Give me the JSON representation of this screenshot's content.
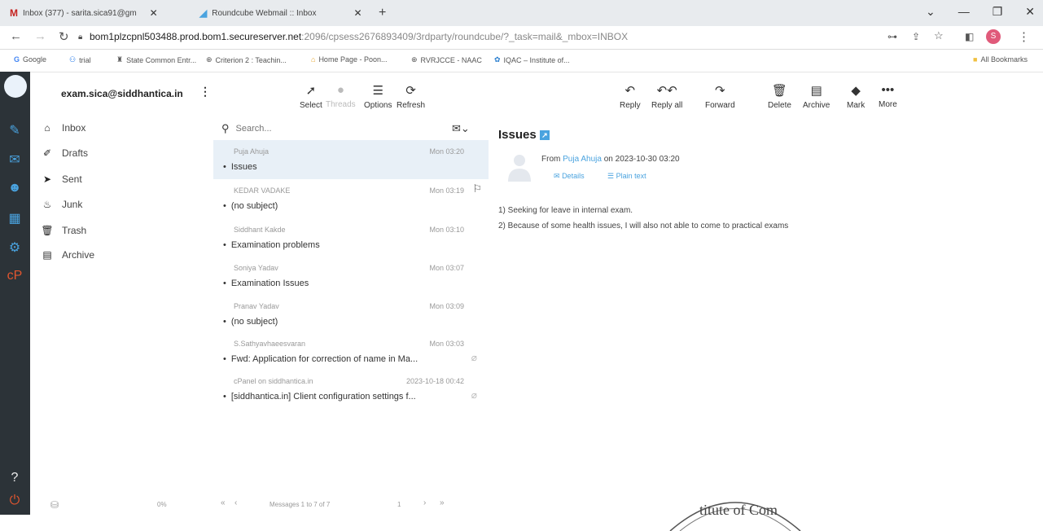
{
  "browser": {
    "tabs": [
      {
        "icon": "M",
        "title": "Inbox (377) - sarita.sica91@gm"
      },
      {
        "icon": "◢",
        "title": "Roundcube Webmail :: Inbox"
      }
    ],
    "new_tab": "+",
    "url_host": "bom1plzcpnl503488.prod.bom1.secureserver.net",
    "url_rest": ":2096/cpsess2676893409/3rdparty/roundcube/?_task=mail&_mbox=INBOX",
    "bookmarks": [
      "Google",
      "trial",
      "State Common Entr...",
      "Criterion 2 : Teachin...",
      "Home Page - Poon...",
      "RVRJCCE - NAAC",
      "IQAC – Institute of..."
    ],
    "all_bookmarks": "All Bookmarks",
    "profile_letter": "S"
  },
  "account": {
    "email": "exam.sica@siddhantica.in"
  },
  "folders": [
    {
      "icon": "inbox-icon",
      "label": "Inbox"
    },
    {
      "icon": "pencil-icon",
      "label": "Drafts"
    },
    {
      "icon": "paper-plane-icon",
      "label": "Sent"
    },
    {
      "icon": "fire-icon",
      "label": "Junk"
    },
    {
      "icon": "trash-icon",
      "label": "Trash"
    },
    {
      "icon": "archive-icon",
      "label": "Archive"
    }
  ],
  "list_toolbar": {
    "select": "Select",
    "threads": "Threads",
    "options": "Options",
    "refresh": "Refresh"
  },
  "search": {
    "placeholder": "Search..."
  },
  "messages": [
    {
      "from": "Puja Ahuja",
      "date": "Mon 03:20",
      "subject": "Issues",
      "selected": true
    },
    {
      "from": "KEDAR VADAKE",
      "date": "Mon 03:19",
      "subject": "(no subject)",
      "flag": true
    },
    {
      "from": "Siddhant Kakde",
      "date": "Mon 03:10",
      "subject": "Examination problems"
    },
    {
      "from": "Soniya Yadav",
      "date": "Mon 03:07",
      "subject": "Examination Issues"
    },
    {
      "from": "Pranav Yadav",
      "date": "Mon 03:09",
      "subject": "(no subject)"
    },
    {
      "from": "S.Sathyavhaeesvaran",
      "date": "Mon 03:03",
      "subject": "Fwd: Application for correction of name in Ma...",
      "attachment": true
    },
    {
      "from": "cPanel on siddhantica.in",
      "date": "2023-10-18 00:42",
      "subject": "[siddhantica.in] Client configuration settings f...",
      "attachment": true
    }
  ],
  "mail_toolbar": {
    "reply": "Reply",
    "reply_all": "Reply all",
    "forward": "Forward",
    "delete": "Delete",
    "archive": "Archive",
    "mark": "Mark",
    "more": "More"
  },
  "preview": {
    "title": "Issues",
    "from_prefix": "From",
    "from_name": "Puja Ahuja",
    "date_text": "on 2023-10-30 03:20",
    "details": "Details",
    "plain_text": "Plain text",
    "body": [
      "1) Seeking for leave in internal exam.",
      "2) Because of some health issues, I will also not able to come to practical exams"
    ]
  },
  "footer": {
    "quota": "0%",
    "count": "Messages 1 to 7 of 7",
    "page": "1"
  },
  "stamp_text": "titute of Com",
  "colors": {
    "accent": "#4aa3df",
    "sidebar": "#2c3338",
    "selected_row": "#e8f0f7"
  }
}
